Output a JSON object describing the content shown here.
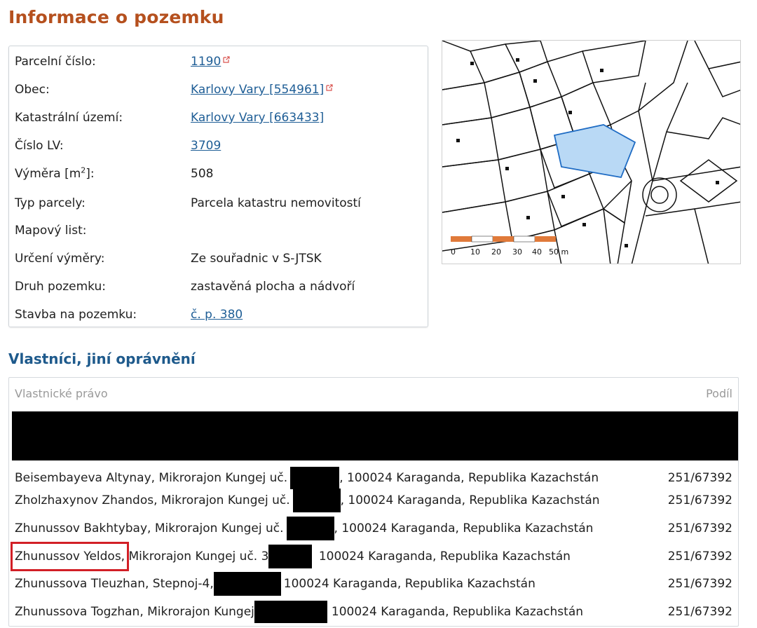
{
  "section_title": "Informace o pozemku",
  "info": {
    "parcel_number_label": "Parcelní číslo:",
    "parcel_number": "1190",
    "obec_label": "Obec:",
    "obec": "Karlovy Vary [554961]",
    "cadastral_label": "Katastrální území:",
    "cadastral": "Karlovy Vary [663433]",
    "lv_label": "Číslo LV:",
    "lv": "3709",
    "area_label_text": "Výměra [m",
    "area_label_sup": "2",
    "area_label_end": "]:",
    "area": "508",
    "parcel_type_label": "Typ parcely:",
    "parcel_type": "Parcela katastru nemovitostí",
    "map_sheet_label": "Mapový list:",
    "map_sheet": "",
    "area_method_label": "Určení výměry:",
    "area_method": "Ze souřadnic v S-JTSK",
    "land_type_label": "Druh pozemku:",
    "land_type": "zastavěná plocha a nádvoří",
    "building_label": "Stavba na pozemku:",
    "building": "č. p. 380"
  },
  "map": {
    "scale_labels": [
      "0",
      "10",
      "20",
      "30",
      "40",
      "50 m"
    ],
    "highlight_color": "#b9d9f5"
  },
  "owners_title": "Vlastníci, jiní oprávnění",
  "owners": {
    "col_right": "Vlastnické právo",
    "col_share": "Podíl",
    "rows": [
      {
        "name": "Beisembayeva Altynay, Mikrorajon Kungej uč.",
        "address": ", 100024 Karaganda, Republika Kazachstán",
        "share": "251/67392"
      },
      {
        "name": "Zholzhaxynov Zhandos, Mikrorajon Kungej uč.",
        "address": ", 100024 Karaganda, Republika Kazachstán",
        "share": "251/67392"
      },
      {
        "name": "Zhunussov Bakhtybay, Mikrorajon Kungej uč.",
        "address": ", 100024 Karaganda, Republika Kazachstán",
        "share": "251/67392"
      },
      {
        "name": "Zhunussov Yeldos,",
        "name_rest": " Mikrorajon Kungej uč. 3",
        "address": " 100024 Karaganda, Republika Kazachstán",
        "share": "251/67392"
      },
      {
        "name": "Zhunussova Tleuzhan, Stepnoj-4,",
        "address": "100024 Karaganda, Republika Kazachstán",
        "share": "251/67392"
      },
      {
        "name": "Zhunussova Togzhan, Mikrorajon Kungej",
        "address": "100024 Karaganda, Republika Kazachstán",
        "share": "251/67392"
      }
    ]
  },
  "colors": {
    "heading_orange": "#b5501e",
    "heading_blue": "#1e5a8c",
    "link": "#1f5e96",
    "highlight_red": "#d21f26"
  }
}
